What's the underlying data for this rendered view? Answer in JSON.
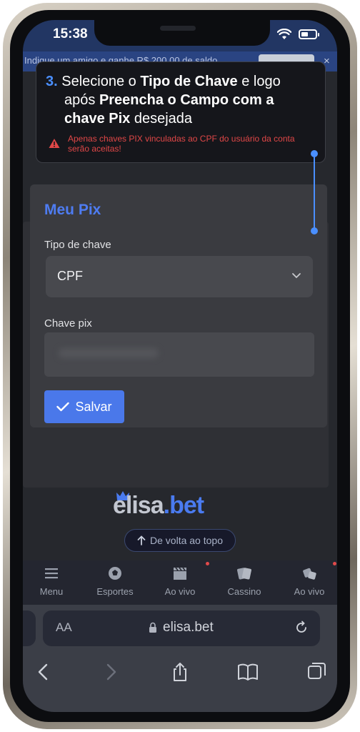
{
  "status_bar": {
    "time": "15:38"
  },
  "promo": {
    "text": "Indique um amigo e ganhe R$ 200,00 de saldo",
    "close": "×"
  },
  "tooltip": {
    "step_number": "3.",
    "line1_a": " Selecione o ",
    "line1_b": "Tipo de Chave",
    "line1_c": " e logo",
    "line2_a": "após ",
    "line2_b": "Preencha o Campo com a",
    "line3_a": "chave Pix",
    "line3_b": " desejada",
    "warning": "Apenas chaves PIX vinculadas ao CPF do usuário da conta serão aceitas!"
  },
  "form": {
    "title": "Meu Pix",
    "key_type_label": "Tipo de chave",
    "key_type_value": "CPF",
    "pix_key_label": "Chave pix",
    "save_label": "Salvar"
  },
  "footer": {
    "logo_a": "elisa",
    "logo_b": ".bet",
    "back_to_top": "De volta ao topo"
  },
  "nav": {
    "items": [
      {
        "label": "Menu",
        "icon": "menu-icon"
      },
      {
        "label": "Esportes",
        "icon": "soccer-ball-icon"
      },
      {
        "label": "Ao vivo",
        "icon": "clapperboard-icon"
      },
      {
        "label": "Cassino",
        "icon": "cards-icon"
      },
      {
        "label": "Ao vivo",
        "icon": "dice-icon"
      }
    ]
  },
  "browser": {
    "aa": "AA",
    "url": "elisa.bet"
  },
  "colors": {
    "accent": "#4a78ea",
    "warning": "#e04747",
    "tooltip_accent": "#4a8fff"
  }
}
